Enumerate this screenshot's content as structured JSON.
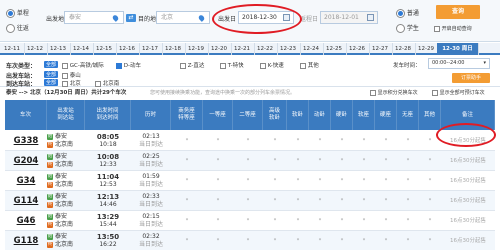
{
  "query": {
    "trip_types": [
      "单程",
      "往返"
    ],
    "from_label": "出发地",
    "from_value": "泰安",
    "to_label": "目的地",
    "to_value": "北京",
    "depart_label": "出发日",
    "depart_value": "2018-12-30",
    "return_label": "返程日",
    "return_value": "2018-12-01",
    "passenger_types": [
      "普通",
      "学生"
    ],
    "search_button": "查询",
    "auto_query_label": "开启自动查询"
  },
  "date_tabs": [
    "12-11",
    "12-12",
    "12-13",
    "12-14",
    "12-15",
    "12-16",
    "12-17",
    "12-18",
    "12-19",
    "12-20",
    "12-21",
    "12-22",
    "12-23",
    "12-24",
    "12-25",
    "12-26",
    "12-27",
    "12-28",
    "12-29",
    "12-30 周日"
  ],
  "filters": {
    "type_label": "车次类型：",
    "type_all": "全部",
    "type_options": [
      "GC-高铁/城际",
      "D-动车",
      "Z-直达",
      "T-特快",
      "K-快速",
      "其他"
    ],
    "depart_time_label": "发车时间：",
    "depart_time_value": "00:00--24:00",
    "from_station_label": "出发车站：",
    "from_station_all": "全部",
    "from_station_option": "泰山",
    "to_station_label": "到达车站：",
    "to_station_all": "全部",
    "to_station_options": [
      "北京",
      "北京南"
    ],
    "filter_button": "订票助手"
  },
  "route": {
    "summary": "泰安 --> 北京（12月30日 周日）共计29个车次",
    "hint": "您可使用接续换乘功能，查询途中换乘一次的部分列车余票情况。",
    "opt1": "显示积分兑换车次",
    "opt2": "显示全部可预订车次"
  },
  "table": {
    "headers": [
      "车次",
      "出发站\n到达站",
      "出发时间\n到达时间",
      "历时",
      "商务座\n特等座",
      "一等座",
      "二等座",
      "高级\n软卧",
      "软卧",
      "动卧",
      "硬卧",
      "软座",
      "硬座",
      "无座",
      "其他",
      "备注"
    ],
    "rows": [
      {
        "train": "G338",
        "from": "泰安",
        "to": "北京南",
        "dep": "08:05",
        "arr": "10:18",
        "dur": "02:13",
        "day": "当日到达",
        "note": "16点30分起售"
      },
      {
        "train": "G204",
        "from": "泰安",
        "to": "北京南",
        "dep": "10:08",
        "arr": "12:33",
        "dur": "02:25",
        "day": "当日到达",
        "note": "16点30分起售"
      },
      {
        "train": "G34",
        "from": "泰安",
        "to": "北京南",
        "dep": "11:04",
        "arr": "12:53",
        "dur": "01:59",
        "day": "当日到达",
        "note": "16点30分起售"
      },
      {
        "train": "G114",
        "from": "泰安",
        "to": "北京南",
        "dep": "12:13",
        "arr": "14:46",
        "dur": "02:33",
        "day": "当日到达",
        "note": "16点30分起售"
      },
      {
        "train": "G46",
        "from": "泰安",
        "to": "北京南",
        "dep": "13:29",
        "arr": "15:44",
        "dur": "02:15",
        "day": "当日到达",
        "note": "16点30分起售"
      },
      {
        "train": "G118",
        "from": "泰安",
        "to": "北京南",
        "dep": "13:50",
        "arr": "16:22",
        "dur": "02:32",
        "day": "当日到达",
        "note": "16点30分起售"
      }
    ],
    "seat_placeholder": "*"
  },
  "accent_color": "#3b7bc0",
  "highlight_color": "#e01c24"
}
